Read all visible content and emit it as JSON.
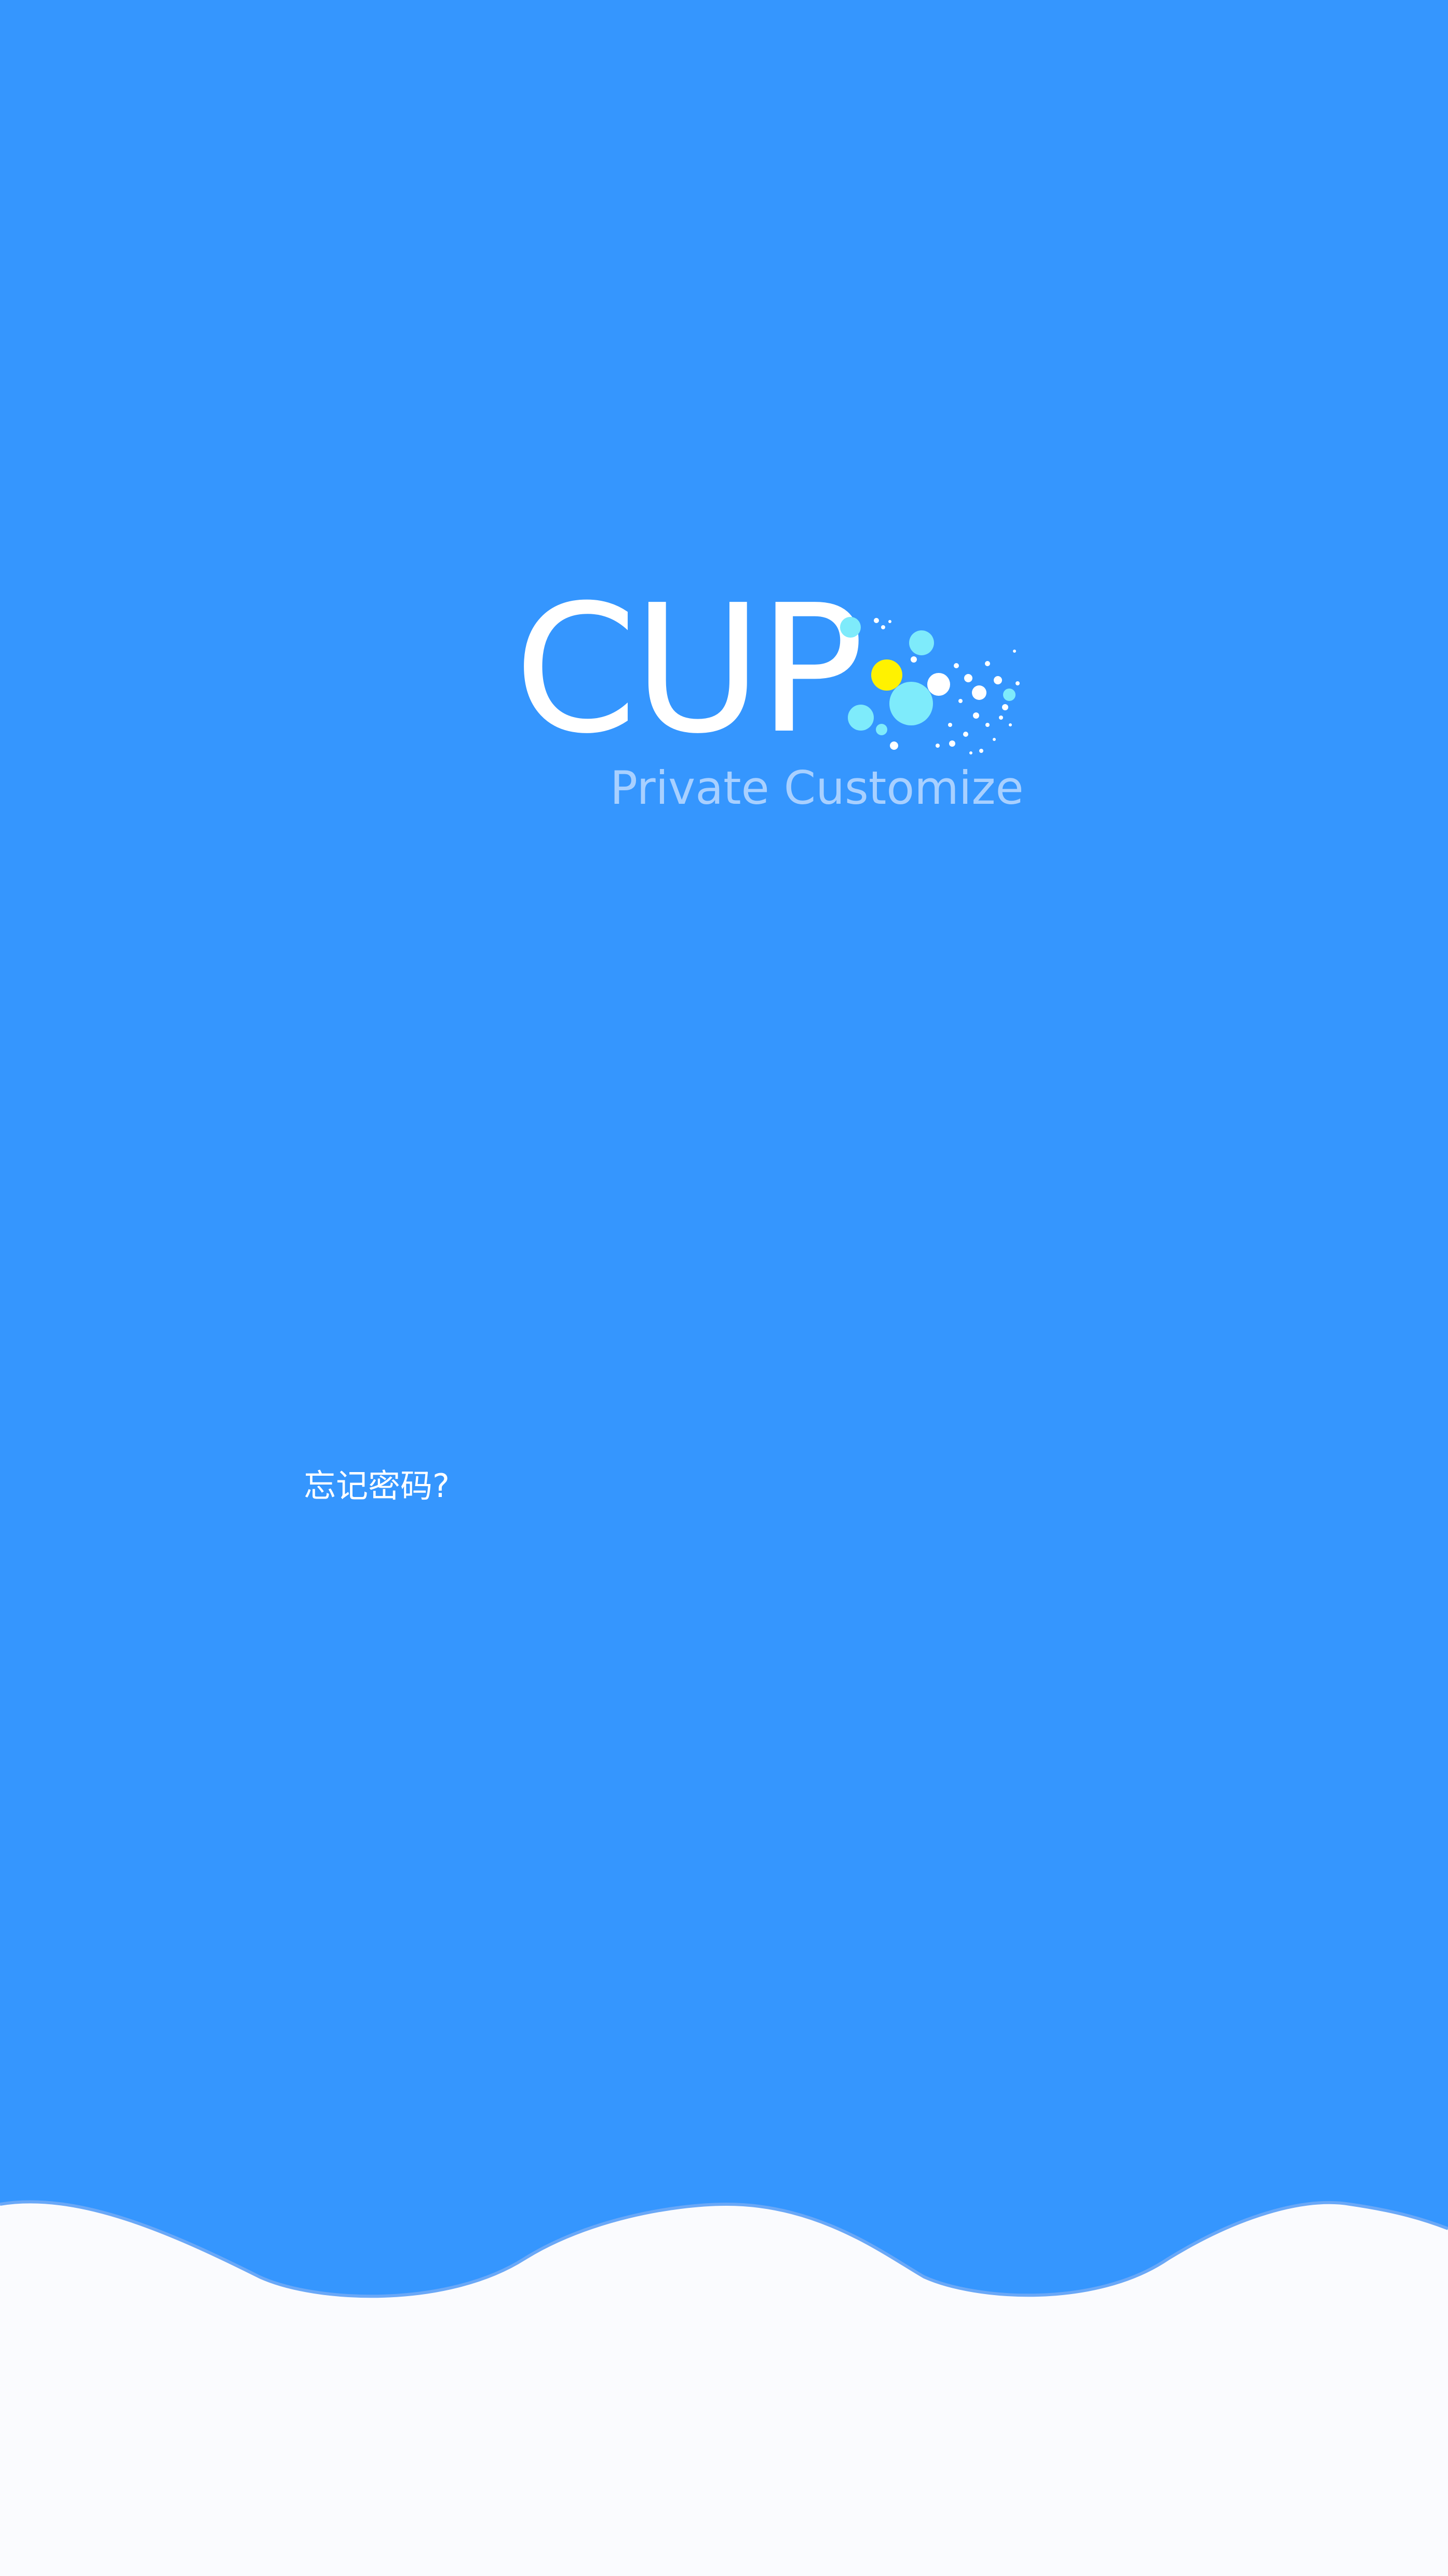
{
  "app": {
    "logo_text": "CUP",
    "tagline": "Private Customize"
  },
  "login": {
    "forgot_password": "忘记密码?"
  },
  "colors": {
    "background": "#3596FE",
    "wave_fill": "#FAFBFE",
    "logo_text": "#FFFFFF",
    "tagline_text": "#A8D0FF",
    "bubble_cyan": "#7EEBFB",
    "bubble_yellow": "#FFF200",
    "bubble_white": "#FFFFFF"
  },
  "icons": {
    "logo_decoration": "bubbles-icon"
  }
}
